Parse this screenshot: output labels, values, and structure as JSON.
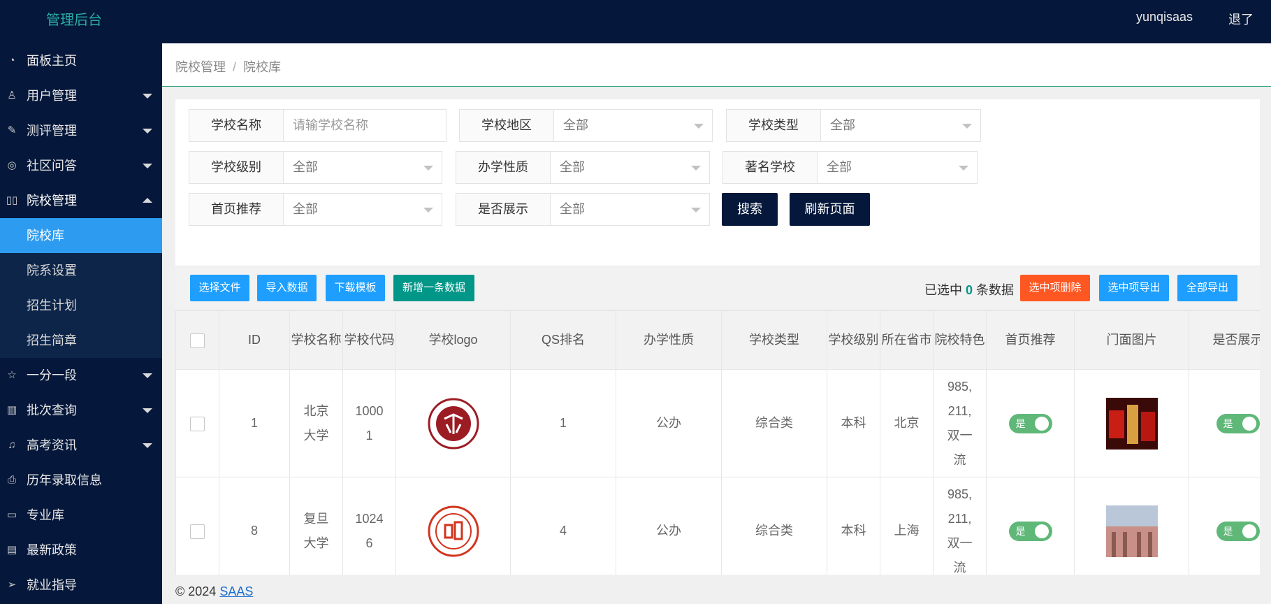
{
  "app": {
    "title": "管理后台",
    "user": "yunqisaas",
    "logout": "退了"
  },
  "sidebar": {
    "items": [
      {
        "label": "面板主页",
        "icon": "dashboard-icon"
      },
      {
        "label": "用户管理",
        "icon": "user-icon"
      },
      {
        "label": "测评管理",
        "icon": "edit-icon"
      },
      {
        "label": "社区问答",
        "icon": "chat-icon"
      },
      {
        "label": "院校管理",
        "icon": "school-icon"
      },
      {
        "label": "一分一段",
        "icon": "star-icon"
      },
      {
        "label": "批次查询",
        "icon": "chart-icon"
      },
      {
        "label": "高考资讯",
        "icon": "bell-icon"
      },
      {
        "label": "历年录取信息",
        "icon": "printer-icon"
      },
      {
        "label": "专业库",
        "icon": "book-icon"
      },
      {
        "label": "最新政策",
        "icon": "clipboard-icon"
      },
      {
        "label": "就业指导",
        "icon": "send-icon"
      }
    ],
    "subitems": [
      "院校库",
      "院系设置",
      "招生计划",
      "招生简章"
    ]
  },
  "breadcrumb": {
    "parent": "院校管理",
    "separator": "/",
    "current": "院校库"
  },
  "filters": {
    "school_name": {
      "label": "学校名称",
      "placeholder": "请输学校名称"
    },
    "region": {
      "label": "学校地区",
      "value": "全部"
    },
    "type": {
      "label": "学校类型",
      "value": "全部"
    },
    "level": {
      "label": "学校级别",
      "value": "全部"
    },
    "nature": {
      "label": "办学性质",
      "value": "全部"
    },
    "famous": {
      "label": "著名学校",
      "value": "全部"
    },
    "recommend": {
      "label": "首页推荐",
      "value": "全部"
    },
    "show": {
      "label": "是否展示",
      "value": "全部"
    },
    "search_button": "搜索",
    "refresh_button": "刷新页面"
  },
  "toolbar": {
    "choose_file": "选择文件",
    "import_data": "导入数据",
    "download_template": "下载模板",
    "add_new": "新增一条数据",
    "selected_prefix": "已选中",
    "selected_count": "0",
    "selected_suffix": "条数据",
    "delete_selected": "选中项删除",
    "export_selected": "选中项导出",
    "export_all": "全部导出"
  },
  "table": {
    "headers": [
      "ID",
      "学校名称",
      "学校代码",
      "学校logo",
      "QS排名",
      "办学性质",
      "学校类型",
      "学校级别",
      "所在省市",
      "院校特色",
      "首页推荐",
      "门面图片",
      "是否展示"
    ],
    "rows": [
      {
        "id": "1",
        "name": "北京大学",
        "code": "10001",
        "logo": "peking-university-logo",
        "qs": "1",
        "nature": "公办",
        "type": "综合类",
        "level": "本科",
        "province": "北京",
        "feature": "985, 211, 双一流",
        "recommend": "是",
        "show": "是"
      },
      {
        "id": "8",
        "name": "复旦大学",
        "code": "10246",
        "logo": "fudan-university-logo",
        "qs": "4",
        "nature": "公办",
        "type": "综合类",
        "level": "本科",
        "province": "上海",
        "feature": "985, 211, 双一流",
        "recommend": "是",
        "show": "是"
      }
    ]
  },
  "footer": {
    "copyright": "© 2024",
    "link": "SAAS"
  }
}
